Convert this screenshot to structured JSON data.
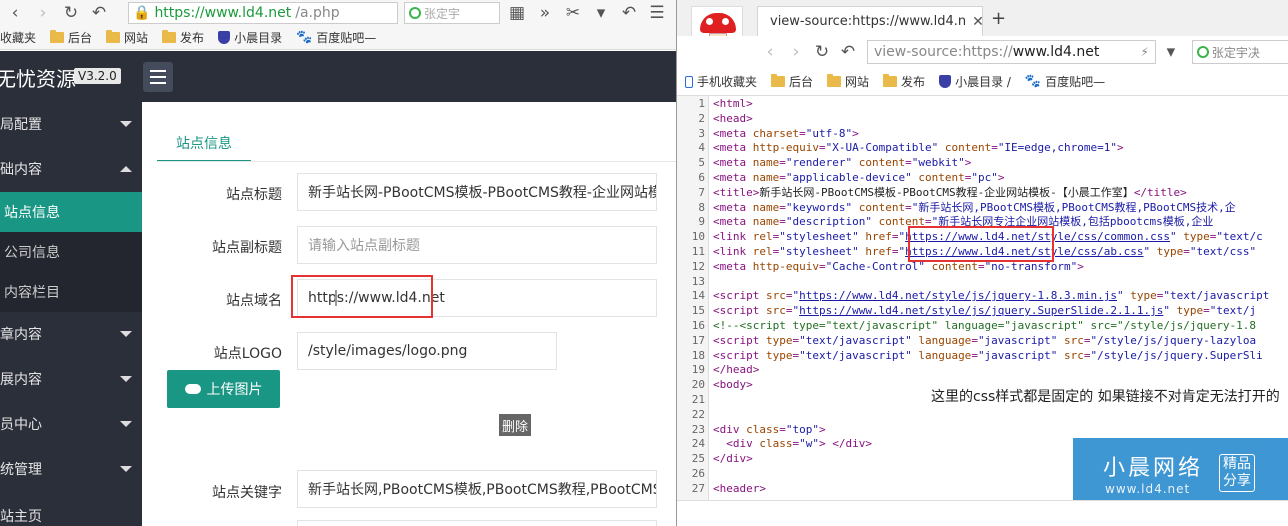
{
  "left": {
    "toolbar": {
      "url_green": "https://www.ld4.net",
      "url_rest": "/a.php",
      "search_text": "张定宇",
      "more": "»",
      "menu": "☰"
    },
    "bookmarks": [
      "收藏夹",
      "后台",
      "网站",
      "发布",
      "小晨目录",
      "百度贴吧—"
    ],
    "header": {
      "brand": "无忧资源",
      "version": "V3.2.0"
    },
    "sidebar": {
      "items": [
        {
          "label": "局配置",
          "expanded": false
        },
        {
          "label": "础内容",
          "expanded": true
        },
        {
          "label": "站点信息",
          "sub": true,
          "active": true
        },
        {
          "label": "公司信息",
          "sub": true,
          "active": false
        },
        {
          "label": "内容栏目",
          "sub": true,
          "active": false
        },
        {
          "label": "章内容",
          "expanded": false
        },
        {
          "label": "展内容",
          "expanded": false
        },
        {
          "label": "员中心",
          "expanded": false
        },
        {
          "label": "统管理",
          "expanded": false
        },
        {
          "label": "站主页",
          "expanded": false
        }
      ]
    },
    "form": {
      "tab": "站点信息",
      "title_label": "站点标题",
      "title_value": "新手站长网-PBootCMS模板-PBootCMS教程-企业网站模",
      "subtitle_label": "站点副标题",
      "subtitle_placeholder": "请输入站点副标题",
      "domain_label": "站点域名",
      "domain_value": "https://www.ld4.net",
      "logo_label": "站点LOGO",
      "logo_value": "/style/images/logo.png",
      "upload_label": "上传图片",
      "delete_label": "删除",
      "keywords_label": "站点关键字",
      "keywords_value": "新手站长网,PBootCMS模板,PBootCMS教程,PBootCMS技"
    }
  },
  "right": {
    "tab_title": "view-source:https://www.ld4.n",
    "url_prefix": "view-source:https://",
    "url_host": "www.ld4.net",
    "search_text": "张定宇决",
    "bookmarks": [
      "手机收藏夹",
      "后台",
      "网站",
      "发布",
      "小晨目录 /",
      "百度贴吧—"
    ],
    "lines": [
      {
        "n": "1",
        "html": "<span class=t>&lt;html&gt;</span>"
      },
      {
        "n": "2",
        "html": "<span class=t>&lt;head&gt;</span>"
      },
      {
        "n": "3",
        "html": "<span class=t>&lt;meta</span> <span class=a>charset</span>=<span class=v>\"utf-8\"</span><span class=t>&gt;</span>"
      },
      {
        "n": "4",
        "html": "<span class=t>&lt;meta</span> <span class=a>http-equiv</span>=<span class=v>\"X-UA-Compatible\"</span> <span class=a>content</span>=<span class=v>\"IE=edge,chrome=1\"</span><span class=t>&gt;</span>"
      },
      {
        "n": "5",
        "html": "<span class=t>&lt;meta</span> <span class=a>name</span>=<span class=v>\"renderer\"</span> <span class=a>content</span>=<span class=v>\"webkit\"</span><span class=t>&gt;</span>"
      },
      {
        "n": "6",
        "html": "<span class=t>&lt;meta</span> <span class=a>name</span>=<span class=v>\"applicable-device\"</span> <span class=a>content</span>=<span class=v>\"pc\"</span><span class=t>&gt;</span>"
      },
      {
        "n": "7",
        "html": "<span class=t>&lt;title&gt;</span><span class=x0>新手站长网-PBootCMS模板-PBootCMS教程-企业网站模板-【小晨工作室】</span><span class=t>&lt;/title&gt;</span>"
      },
      {
        "n": "8",
        "html": "<span class=t>&lt;meta</span> <span class=a>name</span>=<span class=v>\"keywords\"</span> <span class=a>content</span>=<span class=v>\"新手站长网,PBootCMS模板,PBootCMS教程,PBootCMS技术,企</span>"
      },
      {
        "n": "9",
        "html": "<span class=t>&lt;meta</span> <span class=a>name</span>=<span class=v>\"description\"</span> <span class=a>content</span>=<span class=v>\"新手站长网专注企业网站模板,包括pbootcms模板,企业</span>"
      },
      {
        "n": "10",
        "html": "<span class=t>&lt;link</span> <span class=a>rel</span>=<span class=v>\"stylesheet\"</span> <span class=a>href</span>=<span class=v>\"</span><span class=lk>https://www.ld4.net/style/css/common.css</span><span class=v>\"</span> <span class=a>type</span>=<span class=v>\"text/c</span>"
      },
      {
        "n": "11",
        "html": "<span class=t>&lt;link</span> <span class=a>rel</span>=<span class=v>\"stylesheet\"</span> <span class=a>href</span>=<span class=v>\"</span><span class=lk>https://www.ld4.net/style/css/ab.css</span><span class=v>\"</span> <span class=a>type</span>=<span class=v>\"text/css\"</span>"
      },
      {
        "n": "12",
        "html": "<span class=t>&lt;meta</span> <span class=a>http-equiv</span>=<span class=v>\"Cache-Control\"</span> <span class=a>content</span>=<span class=v>\"no-transform\"</span><span class=t>&gt;</span>"
      },
      {
        "n": "13",
        "html": ""
      },
      {
        "n": "14",
        "html": "<span class=t>&lt;script</span> <span class=a>src</span>=<span class=v>\"</span><span class=lk>https://www.ld4.net/style/js/jquery-1.8.3.min.js</span><span class=v>\"</span> <span class=a>type</span>=<span class=v>\"text/javascript</span>"
      },
      {
        "n": "15",
        "html": "<span class=t>&lt;script</span> <span class=a>src</span>=<span class=v>\"</span><span class=lk>https://www.ld4.net/style/js/jquery.SuperSlide.2.1.1.js</span><span class=v>\"</span> <span class=a>type</span>=<span class=v>\"text/j</span>"
      },
      {
        "n": "16",
        "html": "<span class=c>&lt;!--&lt;script type=\"text/javascript\" language=\"javascript\" src=\"/style/js/jquery-1.8</span>"
      },
      {
        "n": "17",
        "html": "<span class=t>&lt;script</span> <span class=a>type</span>=<span class=v>\"text/javascript\"</span> <span class=a>language</span>=<span class=v>\"javascript\"</span> <span class=a>src</span>=<span class=v>\"/style/js/jquery-lazyloa</span>"
      },
      {
        "n": "18",
        "html": "<span class=t>&lt;script</span> <span class=a>type</span>=<span class=v>\"text/javascript\"</span> <span class=a>language</span>=<span class=v>\"javascript\"</span> <span class=a>src</span>=<span class=v>\"/style/js/jquery.SuperSli</span>"
      },
      {
        "n": "19",
        "html": "<span class=t>&lt;/head&gt;</span>"
      },
      {
        "n": "20",
        "html": "<span class=t>&lt;body&gt;</span>"
      },
      {
        "n": "21",
        "html": ""
      },
      {
        "n": "22",
        "html": ""
      },
      {
        "n": "23",
        "html": "<span class=t>&lt;div</span> <span class=a>class</span>=<span class=v>\"top\"</span><span class=t>&gt;</span>"
      },
      {
        "n": "24",
        "html": "  <span class=t>&lt;div</span> <span class=a>class</span>=<span class=v>\"w\"</span><span class=t>&gt;</span> <span class=t>&lt;/div&gt;</span>"
      },
      {
        "n": "25",
        "html": "<span class=t>&lt;/div&gt;</span>"
      },
      {
        "n": "26",
        "html": ""
      },
      {
        "n": "27",
        "html": "<span class=t>&lt;header&gt;</span>"
      }
    ],
    "note": "这里的css样式都是固定的 如果链接不对肯定无法打开的",
    "watermark": {
      "name": "小晨网络",
      "url": "www.ld4.net",
      "badge_line1": "精品",
      "badge_line2": "分享"
    }
  }
}
